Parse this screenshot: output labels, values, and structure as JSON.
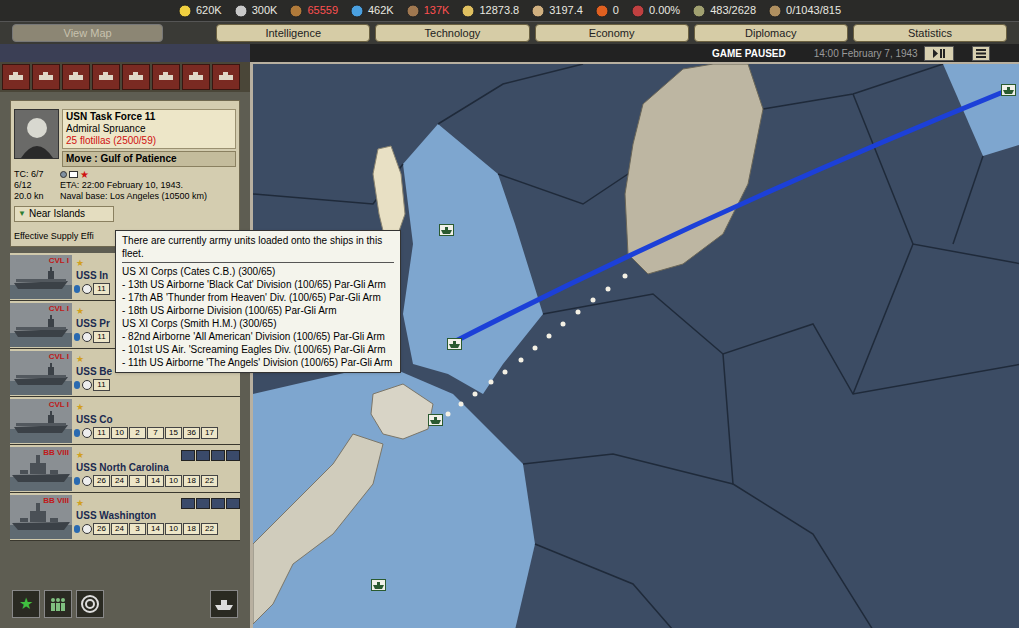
{
  "resources": [
    {
      "value": "620K",
      "alert": false
    },
    {
      "value": "300K",
      "alert": false
    },
    {
      "value": "65559",
      "alert": true
    },
    {
      "value": "462K",
      "alert": false
    },
    {
      "value": "137K",
      "alert": true
    },
    {
      "value": "12873.8",
      "alert": false
    },
    {
      "value": "3197.4",
      "alert": false
    },
    {
      "value": "0",
      "alert": false
    },
    {
      "value": "0.00%",
      "alert": false
    },
    {
      "value": "483/2628",
      "alert": false
    },
    {
      "value": "0/1043/815",
      "alert": false
    }
  ],
  "view_map": {
    "label": "View Map",
    "disabled": true
  },
  "tabs": [
    {
      "label": "Intelligence",
      "selected": false
    },
    {
      "label": "Technology",
      "selected": false
    },
    {
      "label": "Economy",
      "selected": false
    },
    {
      "label": "Diplomacy",
      "selected": false
    },
    {
      "label": "Statistics",
      "selected": false
    }
  ],
  "status": {
    "state": "GAME PAUSED",
    "datetime": "14:00 February 7, 1943"
  },
  "fleet": {
    "name": "USN Task Force 11",
    "commander": "Admiral Spruance",
    "strength": "25 flotillas (2500/59)",
    "order": "Move : Gulf of Patience",
    "transport": "TC: 6/7",
    "org": "6/12",
    "speed": "20.0 kn",
    "eta": "ETA: 22:00 February 10, 1943.",
    "base": "Naval base: Los Angeles (10500 km)",
    "location": "Near Islands",
    "supply": "Effective Supply Effi"
  },
  "ships": [
    {
      "kind": "carrier",
      "class_label": "CVL I",
      "name": "USS In",
      "stats": [
        "11"
      ]
    },
    {
      "kind": "carrier",
      "class_label": "CVL I",
      "name": "USS Pr",
      "stats": [
        "11"
      ]
    },
    {
      "kind": "carrier",
      "class_label": "CVL I",
      "name": "USS Be",
      "stats": [
        "11"
      ]
    },
    {
      "kind": "carrier",
      "class_label": "CVL I",
      "name": "USS Co",
      "stats": [
        "11",
        "10",
        "2",
        "7",
        "15",
        "36",
        "17"
      ]
    },
    {
      "kind": "battleship",
      "class_label": "BB VIII",
      "name": "USS North Carolina",
      "stats": [
        "26",
        "24",
        "3",
        "14",
        "10",
        "18",
        "22"
      ]
    },
    {
      "kind": "battleship",
      "class_label": "BB VIII",
      "name": "USS Washington",
      "stats": [
        "26",
        "24",
        "3",
        "14",
        "10",
        "18",
        "22"
      ]
    }
  ],
  "tooltip": {
    "header": "There are currently army units loaded onto the ships in this fleet.",
    "corps": [
      {
        "name": "US XI Corps (Cates C.B.) (300/65)",
        "divisions": [
          "- 13th US Airborne 'Black Cat' Division (100/65) Par-Gli Arm",
          "- 17th AB 'Thunder from Heaven' Div. (100/65) Par-Gli Arm",
          "- 18th US Airborne Division (100/65) Par-Gli Arm"
        ]
      },
      {
        "name": "US XI Corps (Smith H.M.) (300/65)",
        "divisions": [
          "- 82nd Airborne 'All American' Division (100/65) Par-Gli Arm",
          "- 101st US Air. 'Screaming Eagles Div. (100/65) Par-Gli Arm",
          "- 11th US Airborne 'The Angels' Division (100/65) Par-Gli Arm"
        ]
      }
    ]
  }
}
